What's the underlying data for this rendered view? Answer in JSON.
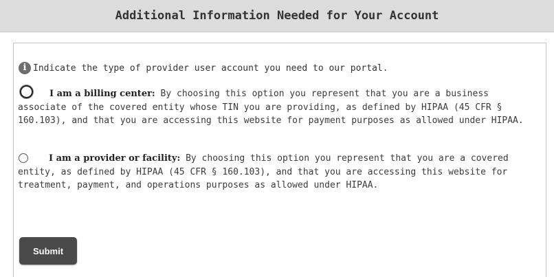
{
  "header": {
    "title": "Additional Information Needed for Your Account"
  },
  "info": {
    "icon": "info-icon",
    "icon_glyph": "i",
    "text": "Indicate the type of provider user account you need to our portal."
  },
  "options": [
    {
      "label": "I am a billing center:",
      "description": " By choosing this option you represent that you are a business associate of the covered entity whose TIN you are providing, as defined by HIPAA (45 CFR § 160.103), and that you are accessing this website for payment purposes as allowed under HIPAA.",
      "selected": false,
      "focused": true
    },
    {
      "label": "I am a provider or facility:",
      "description": " By choosing this option you represent that you are a covered entity, as defined by HIPAA (45 CFR § 160.103), and that you are accessing this website for treatment, payment, and operations purposes as allowed under HIPAA.",
      "selected": false,
      "focused": false
    }
  ],
  "submit": {
    "label": "Submit"
  },
  "colors": {
    "header_bg": "#dcdcdc",
    "button_bg": "#4a4a4a",
    "text": "#3b3b3b"
  }
}
